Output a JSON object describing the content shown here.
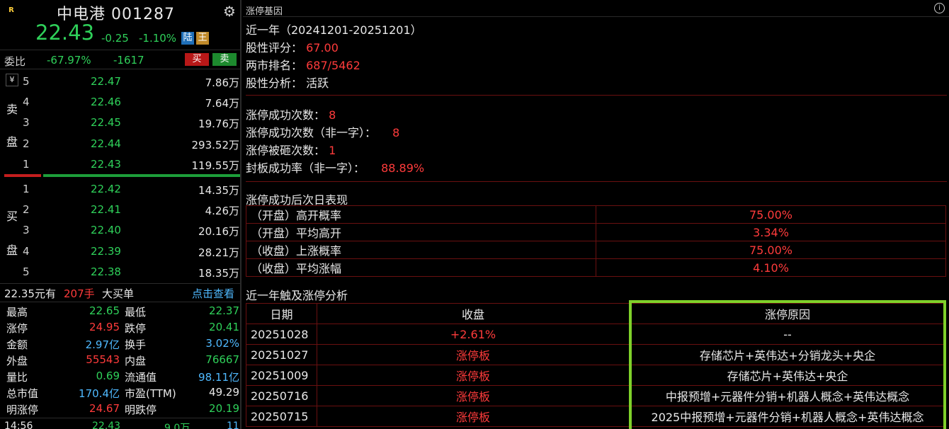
{
  "stock": {
    "logo": "R",
    "name_code": "中电港 001287",
    "price": "22.43",
    "change": "-0.25",
    "change_pct": "-1.10%",
    "tag1": "陆",
    "tag2": "王"
  },
  "weibi": {
    "label": "委比",
    "pct": "-67.97%",
    "diff": "-1617",
    "buy_btn": "买",
    "sell_btn": "卖"
  },
  "sell_book": {
    "side_top": "卖",
    "side_bottom": "盘",
    "yen": "¥",
    "rows": [
      {
        "lv": "5",
        "price": "22.47",
        "vol": "7.86万"
      },
      {
        "lv": "4",
        "price": "22.46",
        "vol": "7.64万"
      },
      {
        "lv": "3",
        "price": "22.45",
        "vol": "19.76万"
      },
      {
        "lv": "2",
        "price": "22.44",
        "vol": "293.52万"
      },
      {
        "lv": "1",
        "price": "22.43",
        "vol": "119.55万"
      }
    ]
  },
  "buy_book": {
    "side_top": "买",
    "side_bottom": "盘",
    "rows": [
      {
        "lv": "1",
        "price": "22.42",
        "vol": "14.35万"
      },
      {
        "lv": "2",
        "price": "22.41",
        "vol": "4.26万"
      },
      {
        "lv": "3",
        "price": "22.40",
        "vol": "20.16万"
      },
      {
        "lv": "4",
        "price": "22.39",
        "vol": "28.21万"
      },
      {
        "lv": "5",
        "price": "22.38",
        "vol": "18.35万"
      }
    ]
  },
  "big_order": {
    "text1": "22.35元有",
    "qty": "207手",
    "text2": "大买单",
    "link": "点击查看"
  },
  "stats": [
    {
      "l1": "最高",
      "v1": "22.65",
      "c1": "green",
      "l2": "最低",
      "v2": "22.37",
      "c2": "green"
    },
    {
      "l1": "涨停",
      "v1": "24.95",
      "c1": "red",
      "l2": "跌停",
      "v2": "20.41",
      "c2": "green"
    },
    {
      "l1": "金额",
      "v1": "2.97亿",
      "c1": "cyan",
      "l2": "换手",
      "v2": "3.02%",
      "c2": "cyan"
    },
    {
      "l1": "外盘",
      "v1": "55543",
      "c1": "red",
      "l2": "内盘",
      "v2": "76667",
      "c2": "green"
    },
    {
      "l1": "量比",
      "v1": "0.69",
      "c1": "green",
      "l2": "流通值",
      "v2": "98.11亿",
      "c2": "cyan"
    },
    {
      "l1": "总市值",
      "v1": "170.4亿",
      "c1": "cyan",
      "l2": "市盈(TTM)",
      "v2": "49.29",
      "c2": "white"
    },
    {
      "l1": "明涨停",
      "v1": "24.67",
      "c1": "red",
      "l2": "明跌停",
      "v2": "20.19",
      "c2": "green"
    }
  ],
  "tick": {
    "time": "14:56",
    "price": "22.43",
    "vol": "9.0万",
    "n": "11"
  },
  "panel": {
    "title": "涨停基因",
    "info_icon": "i",
    "period": "近一年（20241201-20251201）",
    "score_label": "股性评分：",
    "score": "67.00",
    "rank_label": "两市排名：",
    "rank": "687/5462",
    "analysis_label": "股性分析：",
    "analysis": "活跃",
    "succ_label": "涨停成功次数：",
    "succ": "8",
    "succ2_label": "涨停成功次数（非一字）：",
    "succ2": "8",
    "broken_label": "涨停被砸次数：",
    "broken": "1",
    "seal_label": "封板成功率（非一字）：",
    "seal": "88.89%",
    "next_title": "涨停成功后次日表现",
    "next_rows": [
      {
        "label": "（开盘）高开概率",
        "value": "75.00%"
      },
      {
        "label": "（开盘）平均高开",
        "value": "3.34%"
      },
      {
        "label": "（收盘）上涨概率",
        "value": "75.00%"
      },
      {
        "label": "（收盘）平均涨幅",
        "value": "4.10%"
      }
    ],
    "touch_title": "近一年触及涨停分析",
    "touch_headers": [
      "日期",
      "收盘",
      "涨停原因"
    ],
    "touch_rows": [
      {
        "date": "20251028",
        "close": "+2.61%",
        "reason": "--"
      },
      {
        "date": "20251027",
        "close": "涨停板",
        "reason": "存储芯片+英伟达+分销龙头+央企"
      },
      {
        "date": "20251009",
        "close": "涨停板",
        "reason": "存储芯片+英伟达+央企"
      },
      {
        "date": "20250716",
        "close": "涨停板",
        "reason": "中报预增+元器件分销+机器人概念+英伟达概念"
      },
      {
        "date": "20250715",
        "close": "涨停板",
        "reason": "2025中报预增+元器件分销+机器人概念+英伟达概念"
      }
    ]
  },
  "colors": {
    "red": "#ff3b3b",
    "green": "#2fd15a",
    "cyan": "#4fb9ff",
    "highlight": "#7fd12a"
  }
}
